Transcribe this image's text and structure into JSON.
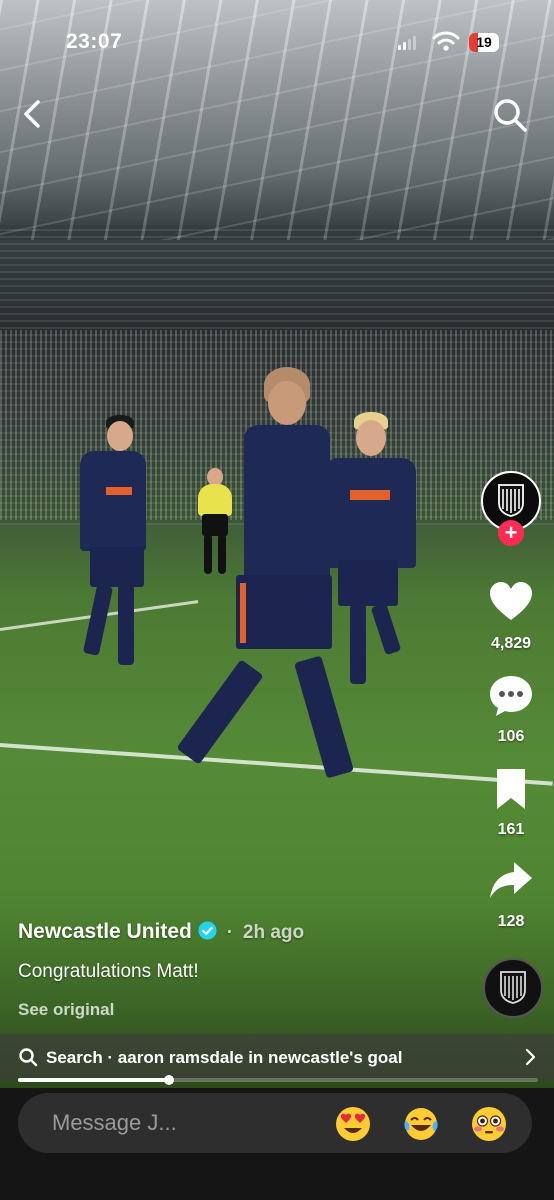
{
  "status": {
    "time": "23:07",
    "battery": "19",
    "battery_level": 0.19
  },
  "actions": {
    "likes": "4,829",
    "comments": "106",
    "saves": "161",
    "shares": "128"
  },
  "post": {
    "author": "Newcastle United",
    "separator": "·",
    "time_ago": "2h ago",
    "caption": "Congratulations Matt!",
    "see_original": "See original"
  },
  "search_bar": {
    "text": "Search · aaron ramsdale in newcastle's goal"
  },
  "video_progress": 0.29,
  "message": {
    "placeholder": "Message J...",
    "emojis": [
      "heart-eyes-emoji",
      "tears-of-joy-emoji",
      "flushed-emoji"
    ]
  },
  "colors": {
    "follow_button": "#fe2c55",
    "verified_badge": "#20d5ec",
    "kit_navy": "#1e2a55",
    "kit_orange": "#e2612c",
    "battery_low": "#e63b30"
  },
  "icons": {
    "back": "chevron-left-icon",
    "search": "search-icon",
    "like": "heart-icon",
    "comment": "comment-icon",
    "save": "bookmark-icon",
    "share": "share-icon"
  }
}
